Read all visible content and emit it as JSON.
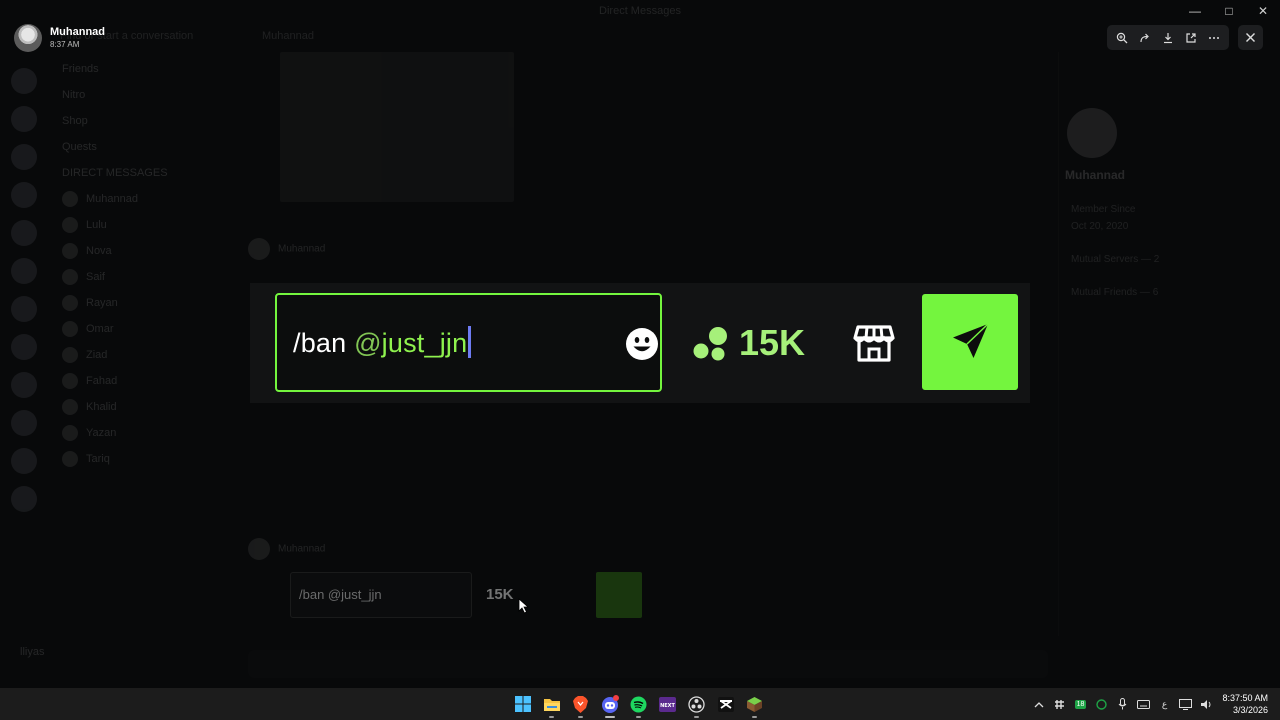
{
  "window": {
    "title": "Direct Messages",
    "controls": [
      "minimize",
      "maximize",
      "close"
    ]
  },
  "background": {
    "search_placeholder": "Find or start a conversation",
    "chat_title": "Muhannad",
    "channels": [
      "Friends",
      "Nitro",
      "Shop",
      "Quests",
      "DIRECT MESSAGES",
      "Muhannad",
      "Lulu",
      "Nova",
      "Saif",
      "Rayan",
      "Omar",
      "Ziad",
      "Fahad",
      "Khalid",
      "Yazan",
      "Tariq"
    ],
    "profile": {
      "name": "Muhannad",
      "member_since_label": "Member Since",
      "member_since": "Oct 20, 2020",
      "mutual_servers": "Mutual Servers — 2",
      "mutual_friends": "Mutual Friends — 6"
    },
    "message_author": "Muhannad",
    "user_name": "lliyas",
    "mini_composer": {
      "text": "/ban @just_jjn",
      "coins": "15K"
    }
  },
  "viewer": {
    "user_name": "Muhannad",
    "time": "8:37 AM",
    "tools": [
      "zoom-in-icon",
      "forward-icon",
      "download-icon",
      "open-external-icon",
      "more-icon"
    ]
  },
  "composer": {
    "command": "/ban ",
    "at_sign": "@",
    "mention": "just_jjn",
    "coins": "15K",
    "colors": {
      "accent": "#74f53e",
      "mention": "#8ff24e",
      "coins": "#a6f07a",
      "caret": "#6e7bf2"
    }
  },
  "taskbar": {
    "apps": [
      "windows-start-icon",
      "file-explorer-icon",
      "brave-browser-icon",
      "discord-icon",
      "spotify-icon",
      "next-app-icon",
      "obs-icon",
      "capcut-icon",
      "minecraft-icon"
    ],
    "tray": {
      "badge": "18",
      "language": "ع"
    },
    "time": "8:37:50 AM",
    "date": "3/3/2026"
  }
}
